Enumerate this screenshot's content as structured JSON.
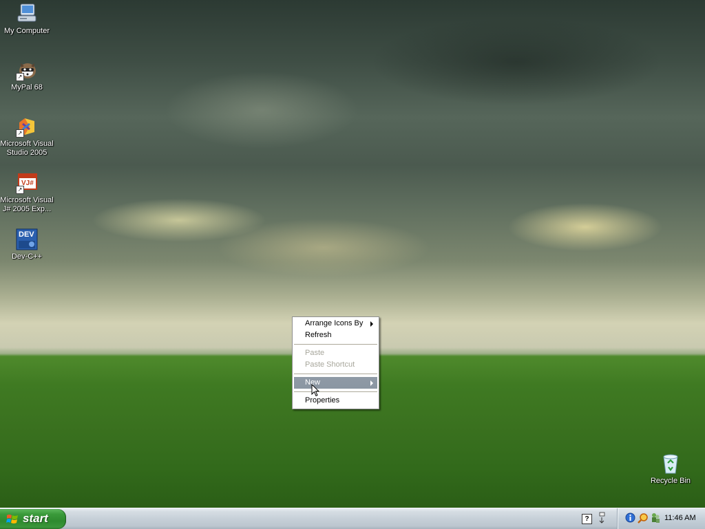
{
  "desktop": {
    "icons": [
      {
        "label": "My Computer",
        "icon": "my-computer-icon"
      },
      {
        "label": "MyPal 68",
        "icon": "mypal-icon"
      },
      {
        "label": "Microsoft Visual Studio 2005",
        "icon": "visual-studio-icon"
      },
      {
        "label": "Microsoft Visual J# 2005 Exp...",
        "icon": "visual-jsharp-icon"
      },
      {
        "label": "Dev-C++",
        "icon": "devcpp-icon"
      },
      {
        "label": "Recycle Bin",
        "icon": "recycle-bin-icon"
      }
    ],
    "vjs_badge": "VJ#",
    "dev_badge": "DEV"
  },
  "context_menu": {
    "items": [
      {
        "label": "Arrange Icons By",
        "has_submenu": true,
        "enabled": true
      },
      {
        "label": "Refresh",
        "enabled": true
      },
      {
        "label": "Paste",
        "enabled": false
      },
      {
        "label": "Paste Shortcut",
        "enabled": false
      },
      {
        "label": "New",
        "has_submenu": true,
        "enabled": true,
        "highlighted": true
      },
      {
        "label": "Properties",
        "enabled": true
      }
    ]
  },
  "taskbar": {
    "start_label": "start",
    "clock": "11:46 AM",
    "tray_icons": [
      "help-icon",
      "network-icon",
      "info-icon",
      "search-icon",
      "users-icon"
    ]
  }
}
